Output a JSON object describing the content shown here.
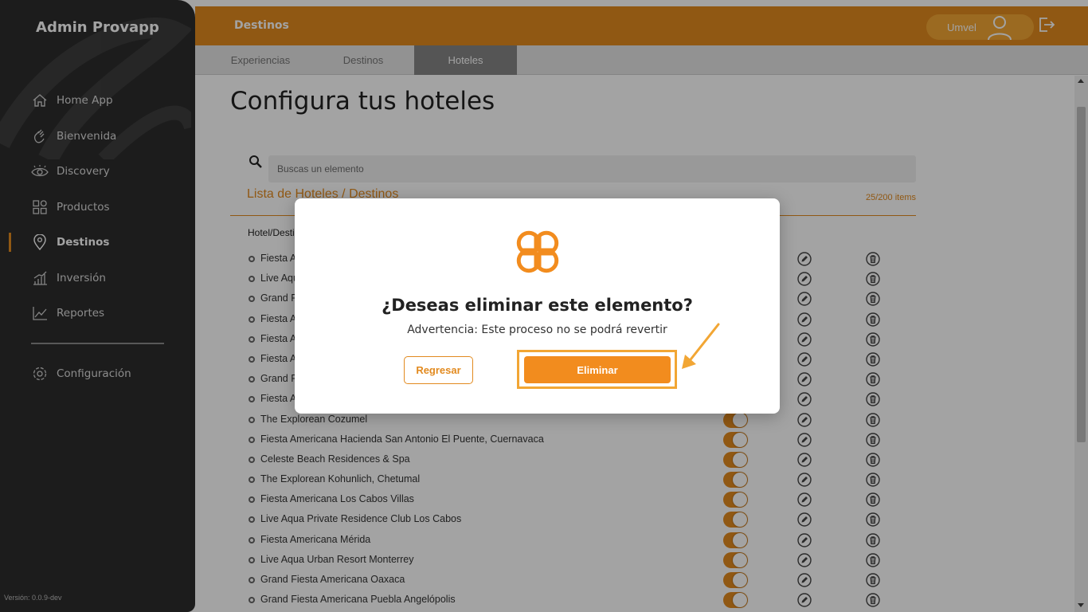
{
  "sidebar": {
    "brand": "Admin Provapp",
    "items": [
      {
        "label": "Home App",
        "icon": "home-icon"
      },
      {
        "label": "Bienvenida",
        "icon": "wave-hand-icon"
      },
      {
        "label": "Discovery",
        "icon": "eye-icon"
      },
      {
        "label": "Productos",
        "icon": "grid-icon"
      },
      {
        "label": "Destinos",
        "icon": "location-pin-icon",
        "active": true
      },
      {
        "label": "Inversión",
        "icon": "bar-chart-icon"
      },
      {
        "label": "Reportes",
        "icon": "trend-line-icon"
      }
    ],
    "config_label": "Configuración",
    "version": "Versión: 0.0.9-dev"
  },
  "topbar": {
    "title": "Destinos",
    "user_name": "Umvel"
  },
  "tabs": [
    {
      "label": "Experiencias"
    },
    {
      "label": "Destinos"
    },
    {
      "label": "Hoteles",
      "active": true
    }
  ],
  "main": {
    "page_title": "Configura tus hoteles",
    "search_placeholder": "Buscas un elemento",
    "list_title": "Lista de Hoteles / Destinos",
    "list_count": "25/200 items",
    "column_header": "Hotel/Destino",
    "rows": [
      "Fiesta Americana Condesa Cancún",
      "Live Aqua Beach Resort Cancún",
      "Grand Fiesta Americana Coral Beach",
      "Fiesta Americana Grand Los Cabos",
      "Fiesta Americana Guadalajara",
      "Fiesta Americana Villas Cancún",
      "Grand Fiesta Americana Monterrey",
      "Fiesta Americana Puerto Vallarta",
      "The Explorean Cozumel",
      "Fiesta Americana Hacienda San Antonio El Puente, Cuernavaca",
      "Celeste Beach Residences & Spa",
      "The Explorean Kohunlich, Chetumal",
      "Fiesta Americana Los Cabos Villas",
      "Live Aqua Private Residence Club Los Cabos",
      "Fiesta Americana Mérida",
      "Live Aqua Urban Resort Monterrey",
      "Grand Fiesta Americana Oaxaca",
      "Grand Fiesta Americana Puebla Angelópolis"
    ]
  },
  "modal": {
    "title": "¿Deseas eliminar este elemento?",
    "warning": "Advertencia: Este proceso no se podrá revertir",
    "back_label": "Regresar",
    "delete_label": "Eliminar"
  },
  "colors": {
    "accent": "#e28a1f",
    "sidebar_bg": "#2c2c2c",
    "button_orange": "#f28c1e"
  }
}
